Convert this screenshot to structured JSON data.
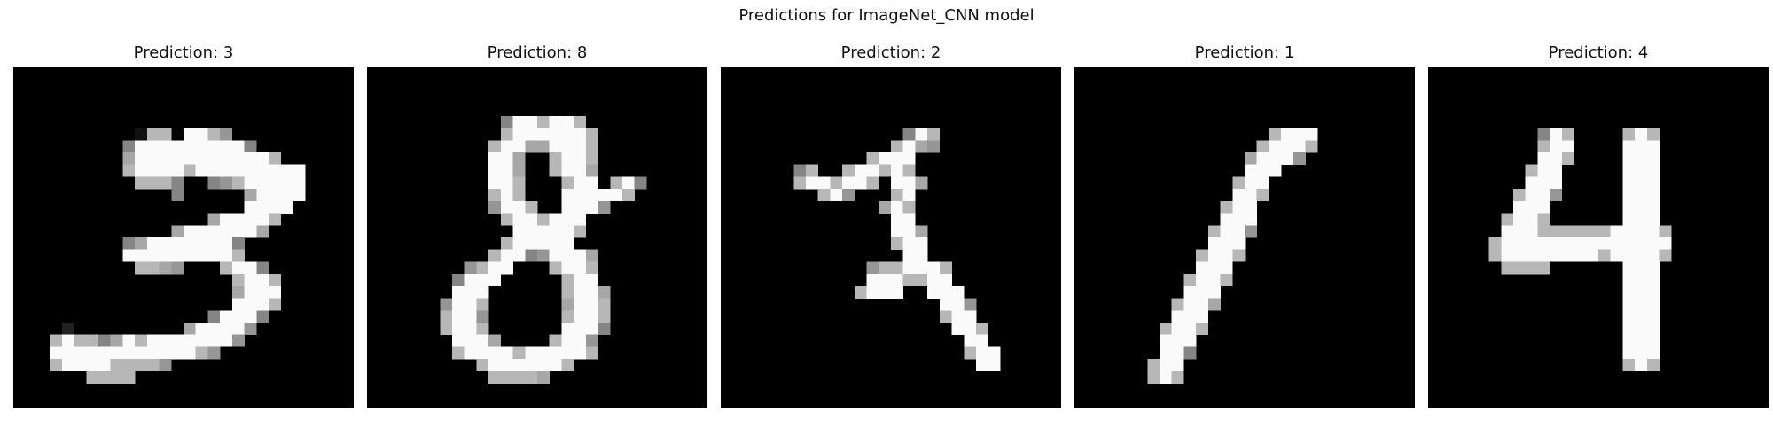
{
  "figure": {
    "title": "Predictions for ImageNet_CNN model"
  },
  "panels": [
    {
      "label": "Prediction: 3",
      "rows": [
        "............................",
        "............................",
        "............................",
        "............................",
        "............................",
        "..........1bb.ffb9..........",
        ".........8fffffffff8........",
        ".........afffffffffffb......",
        ".........bffffbfffffffff....",
        "..........bbb8..89bfffff....",
        ".............8.....affff....",
        "...................ffff.....",
        "................affffb......",
        ".............affffffa.......",
        ".........8afffffff8.........",
        ".........fffffffffb.........",
        "..........bba9...bff8.......",
        "..................bffb......",
        "..................afff......",
        "..................fffb......",
        "................8fff8.......",
        "....2.........affff9........",
        "...bfbb8afbfffffff9.........",
        "...ffffffffffffb9...........",
        "...bffffbbbb9...............",
        "......bbbb..................",
        "............................",
        "............................"
      ]
    },
    {
      "label": "Prediction: 8",
      "rows": [
        "............................",
        "............................",
        "............................",
        "............................",
        "...........8ffbffb..........",
        "...........bffffffb.........",
        "..........bffaafffb.........",
        "..........ffa..bffb.........",
        "..........ffa..bffa.........",
        "..........ffb...bff.bf8.....",
        "..........bfb...fffffb......",
        "..........9ffb..fff9........",
        "...........bffbfff..........",
        "............fffffb..........",
        "...........bfffff...........",
        "..........bff89fffa.........",
        "........9bff...bffb.........",
        ".......8fff.....bff.........",
        ".......fff......bffa........",
        "......9ffb......affb........",
        "......bff9......bffb........",
        "......bffb......fff8........",
        ".......fffa....bff9.........",
        ".......bffffbfffffb.........",
        ".........bffffffb...........",
        "..........bbbba.............",
        "............................",
        "............................"
      ]
    },
    {
      "label": "Prediction: 2",
      "rows": [
        "............................",
        "............................",
        "............................",
        "............................",
        "............................",
        "...............8fb..........",
        "..............bfa9..........",
        "............bfff............",
        "......8b..bffbfb............",
        "......bffbffb.ffa...........",
        "........bf9...bf............",
        ".............afb............",
        "..............ff............",
        "..............ffa...........",
        "..............bff...........",
        "...............ff...........",
        "............9bbfffb.........",
        "............fffbbff.........",
        "...........bfff..fff........",
        "..................ff9.......",
        "..................bff.......",
        "...................ffb......",
        "....................ff......",
        "....................bff.....",
        ".....................ff.....",
        "............................",
        "............................",
        "............................"
      ]
    },
    {
      "label": "Prediction: 1",
      "rows": [
        "............................",
        "............................",
        "............................",
        "............................",
        "............................",
        "................bfff........",
        "...............bfffb........",
        "..............afff9.........",
        "..............fff...........",
        ".............bff............",
        ".............ffb............",
        "............bff.............",
        "............fff.............",
        "...........bff9.............",
        "...........fff..............",
        "..........bffb..............",
        "..........fff...............",
        ".........bffb...............",
        ".........fff................",
        "........bffa................",
        "........fff.................",
        ".......bffb.................",
        ".......fff..................",
        ".......ff8..................",
        "......bff...................",
        "......bfb...................",
        "............................",
        "............................"
      ]
    },
    {
      "label": "Prediction: 4",
      "rows": [
        "............................",
        "............................",
        "............................",
        "............................",
        "............................",
        ".........8fb....bfb.........",
        ".........bff....fff.........",
        ".........ffb....fff.........",
        "........bff.....fff.........",
        "........fff.....fff.........",
        ".......bff9.....fff.........",
        ".......fff......fff.........",
        "......bffb......fff.........",
        "......fffbbbbbbffffb........",
        ".....bffffffffffffff........",
        ".....bffffffffbffffb........",
        "......bbbb......fff.........",
        "................fff.........",
        "................fff.........",
        "................fff.........",
        "................fff.........",
        "................fff.........",
        "................fff.........",
        "................fff.........",
        "................bfb.........",
        "............................",
        "............................",
        "............................"
      ]
    }
  ]
}
